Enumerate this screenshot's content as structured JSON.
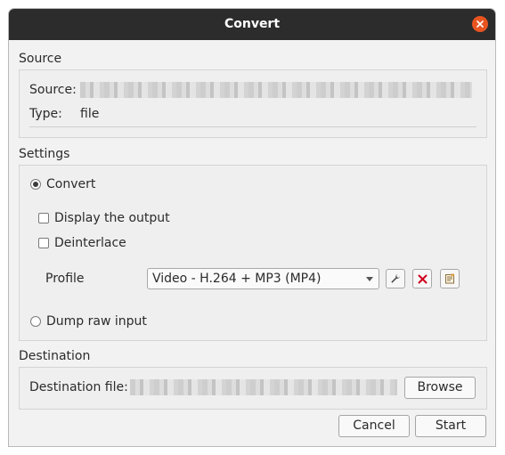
{
  "window": {
    "title": "Convert"
  },
  "source": {
    "section_label": "Source",
    "source_label": "Source:",
    "type_label": "Type:",
    "type_value": "file"
  },
  "settings": {
    "section_label": "Settings",
    "convert_label": "Convert",
    "display_output_label": "Display the output",
    "deinterlace_label": "Deinterlace",
    "profile_label": "Profile",
    "profile_selected": "Video - H.264 + MP3 (MP4)",
    "dump_raw_label": "Dump raw input",
    "convert_checked": true,
    "display_output_checked": false,
    "deinterlace_checked": false
  },
  "destination": {
    "section_label": "Destination",
    "file_label": "Destination file:",
    "browse_label": "Browse"
  },
  "buttons": {
    "cancel_label": "Cancel",
    "start_label": "Start"
  },
  "icons": {
    "close": "close-icon",
    "edit_profile": "wrench-icon",
    "delete_profile": "delete-icon",
    "new_profile": "new-profile-icon"
  },
  "colors": {
    "titlebar": "#2c2c2c",
    "close_button": "#e95420",
    "delete_icon": "#d0021b"
  }
}
